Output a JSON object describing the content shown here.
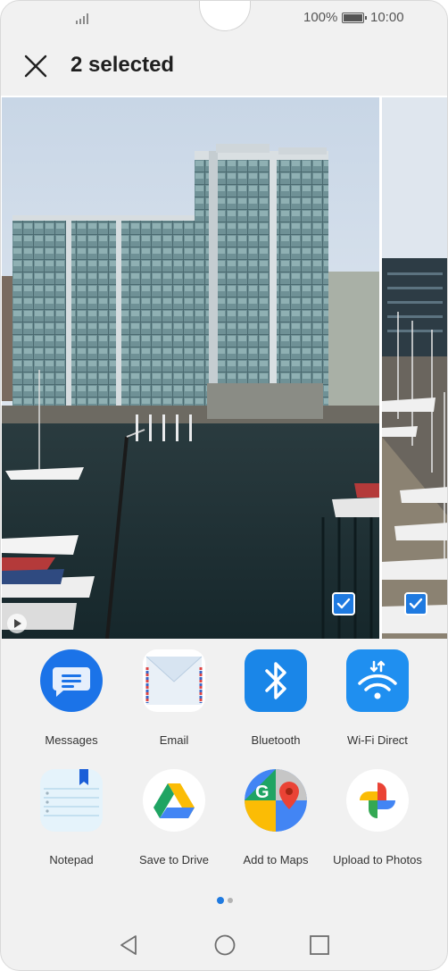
{
  "status_bar": {
    "battery_percent": "100%",
    "time": "10:00"
  },
  "header": {
    "title": "2 selected"
  },
  "photos": [
    {
      "selected": true,
      "is_video": true
    },
    {
      "selected": true,
      "is_video": false
    }
  ],
  "share_targets": [
    {
      "label": "Messages",
      "icon": "messages-icon"
    },
    {
      "label": "Email",
      "icon": "email-icon"
    },
    {
      "label": "Bluetooth",
      "icon": "bluetooth-icon"
    },
    {
      "label": "Wi-Fi Direct",
      "icon": "wifi-direct-icon"
    },
    {
      "label": "Notepad",
      "icon": "notepad-icon"
    },
    {
      "label": "Save to Drive",
      "icon": "google-drive-icon"
    },
    {
      "label": "Add to Maps",
      "icon": "google-maps-icon"
    },
    {
      "label": "Upload to Photos",
      "icon": "google-photos-icon"
    }
  ],
  "pager": {
    "pages": 2,
    "current_page": 1
  },
  "colors": {
    "accent": "#1f7ae0",
    "background": "#f1f1f1"
  }
}
